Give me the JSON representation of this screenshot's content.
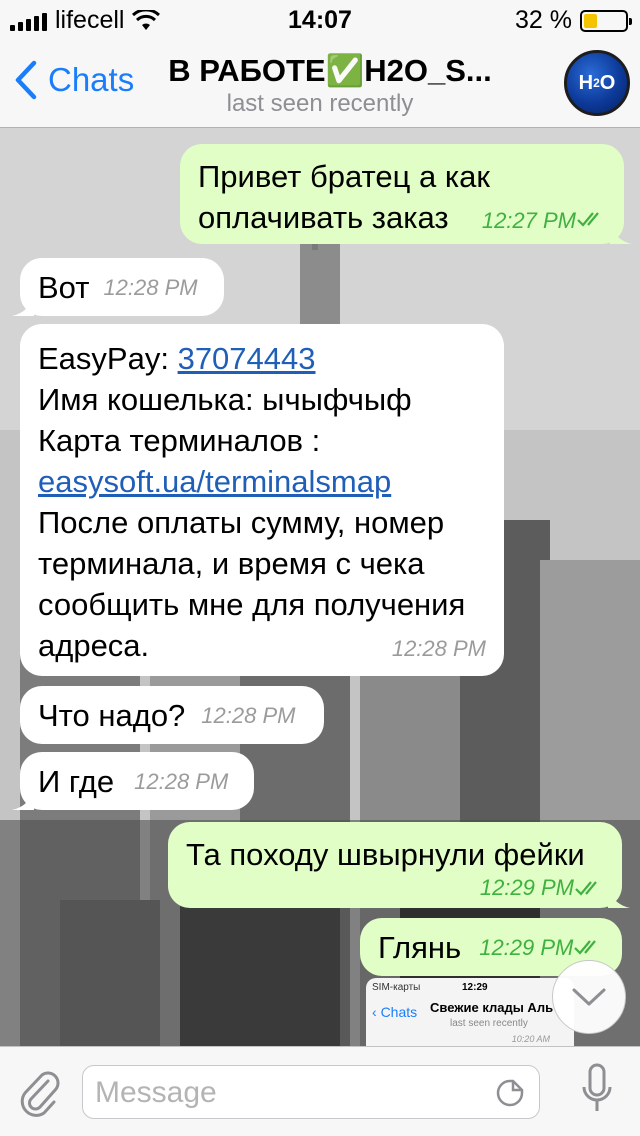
{
  "status_bar": {
    "carrier": "lifecell",
    "time": "14:07",
    "battery_percent": "32 %",
    "battery_level": 0.32,
    "battery_color": "#f5c400"
  },
  "nav": {
    "back_label": "Chats",
    "title": "В РАБОТЕ✅H2O_S...",
    "subtitle": "last seen recently",
    "avatar_text": "H",
    "avatar_sub": "2",
    "avatar_tail": "O"
  },
  "messages": [
    {
      "direction": "out",
      "lines": [
        "Привет братец а как",
        "оплачивать заказ"
      ],
      "time": "12:27 PM",
      "read": true
    },
    {
      "direction": "in",
      "text": "Вот",
      "time": "12:28 PM"
    },
    {
      "direction": "in",
      "time": "12:28 PM",
      "easypay_label": "EasyPay:",
      "easypay_number": "37074443",
      "wallet_line": "Имя кошелька: ычыфчыф",
      "terminals_line": "Карта терминалов :",
      "terminals_link": "easysoft.ua/terminalsmap",
      "after_lines": [
        "После оплаты  сумму, номер",
        "терминала, и время с чека",
        "сообщить мне для получения",
        "адреса."
      ]
    },
    {
      "direction": "in",
      "text": "Что надо?",
      "time": "12:28 PM"
    },
    {
      "direction": "in",
      "text": "И где",
      "time": "12:28 PM"
    },
    {
      "direction": "out",
      "text": "Та походу швырнули фейки",
      "time": "12:29 PM",
      "read": true
    },
    {
      "direction": "out",
      "text": "Глянь",
      "time": "12:29 PM",
      "read": true
    }
  ],
  "preview": {
    "carrier": "SIM-карты",
    "time": "12:29",
    "back_label": "Chats",
    "title": "Свежие клады Аль",
    "subtitle": "last seen recently",
    "msg_time": "10:20 AM"
  },
  "input": {
    "placeholder": "Message"
  },
  "colors": {
    "accent": "#1a7efb",
    "outgoing_bubble": "#e1fec6",
    "incoming_bubble": "#ffffff",
    "read_ticks": "#3fb140"
  }
}
